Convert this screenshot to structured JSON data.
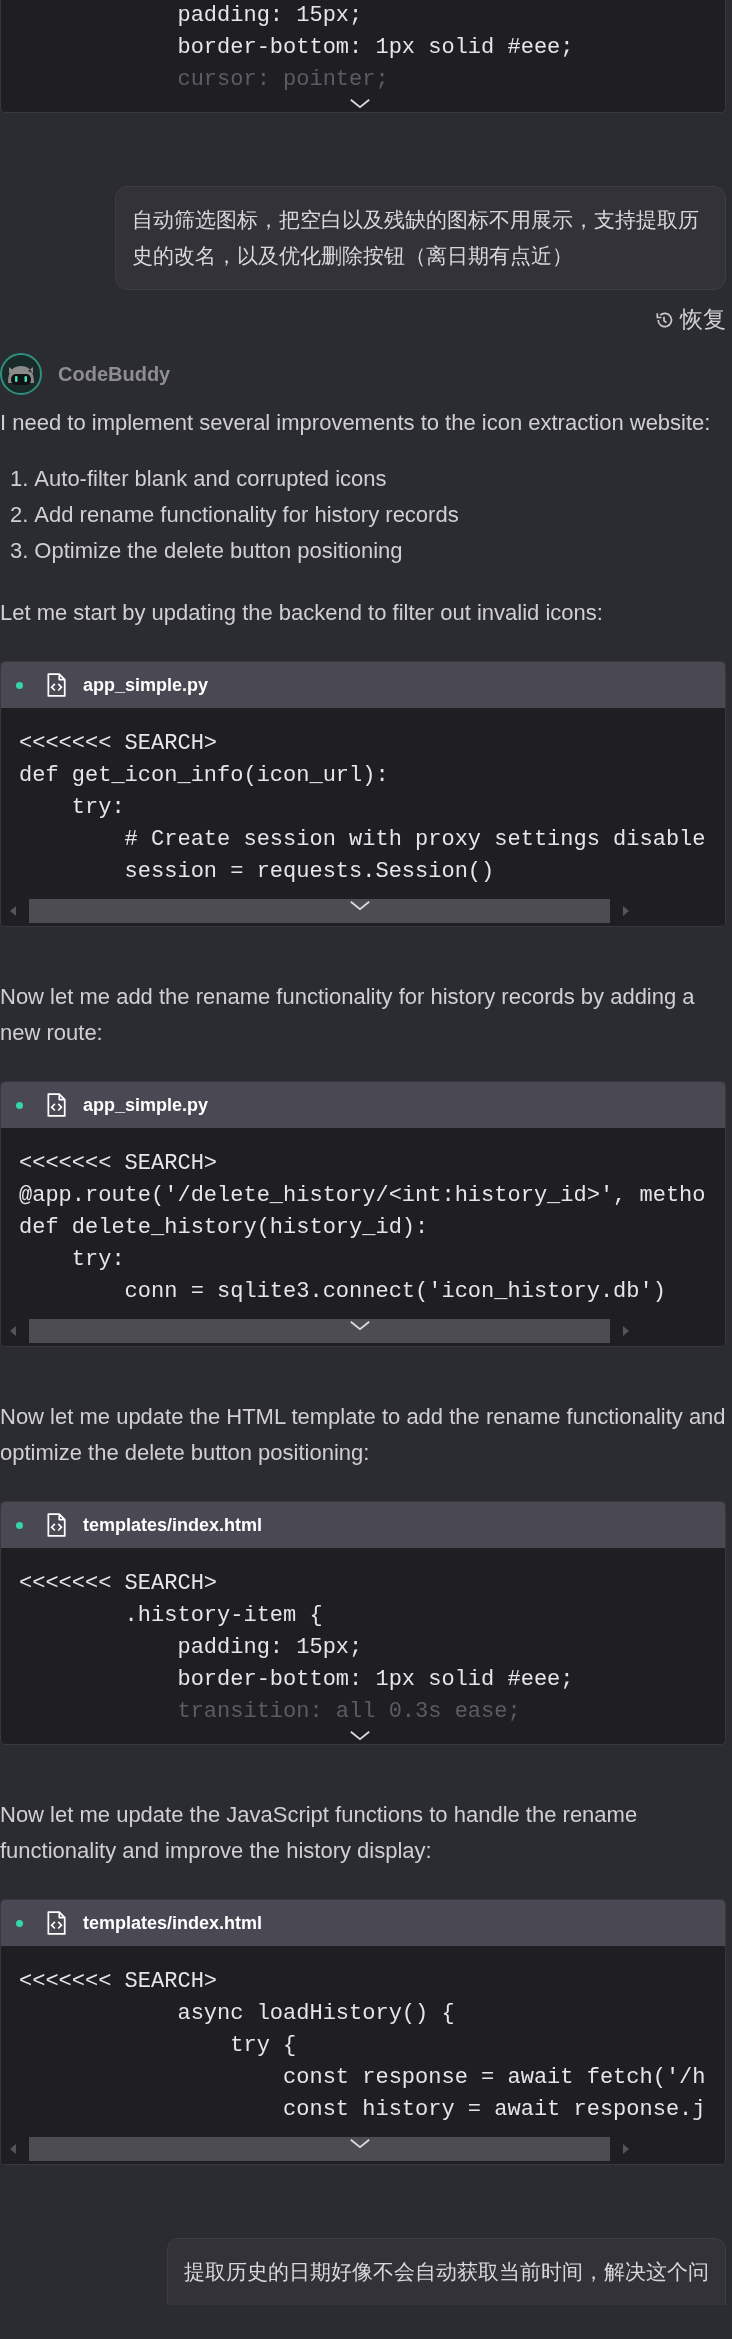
{
  "items": [
    {
      "kind": "code",
      "scrollbar": false,
      "lines": [
        {
          "text": "            padding: 15px;",
          "dim": false
        },
        {
          "text": "            border-bottom: 1px solid #eee;",
          "dim": false
        },
        {
          "text": "            cursor: pointer;",
          "dim": true
        }
      ]
    },
    {
      "kind": "user",
      "text": "自动筛选图标，把空白以及残缺的图标不用展示，支持提取历史的改名，以及优化删除按钮（离日期有点近）",
      "action": "恢复"
    },
    {
      "kind": "assistant",
      "name": "CodeBuddy"
    },
    {
      "kind": "paragraph",
      "text": "I need to implement several improvements to the icon extraction website:"
    },
    {
      "kind": "list",
      "entries": [
        {
          "number": "1.",
          "text": "Auto-filter blank and corrupted icons"
        },
        {
          "number": "2.",
          "text": "Add rename functionality for history records"
        },
        {
          "number": "3.",
          "text": "Optimize the delete button positioning"
        }
      ]
    },
    {
      "kind": "paragraph",
      "text": "Let me start by updating the backend to filter out invalid icons:"
    },
    {
      "kind": "code",
      "file": "app_simple.py",
      "scrollbar": true,
      "lines": [
        {
          "text": "<<<<<<< SEARCH>",
          "dim": false
        },
        {
          "text": "def get_icon_info(icon_url):",
          "dim": false
        },
        {
          "text": "    try:",
          "dim": false
        },
        {
          "text": "        # Create session with proxy settings disable",
          "dim": false
        },
        {
          "text": "        session = requests.Session()",
          "dim": false
        }
      ]
    },
    {
      "kind": "paragraph",
      "text": "Now let me add the rename functionality for history records by adding a new route:"
    },
    {
      "kind": "code",
      "file": "app_simple.py",
      "scrollbar": true,
      "lines": [
        {
          "text": "<<<<<<< SEARCH>",
          "dim": false
        },
        {
          "text": "@app.route('/delete_history/<int:history_id>', metho",
          "dim": false
        },
        {
          "text": "def delete_history(history_id):",
          "dim": false
        },
        {
          "text": "    try:",
          "dim": false
        },
        {
          "text": "        conn = sqlite3.connect('icon_history.db')",
          "dim": false
        }
      ]
    },
    {
      "kind": "paragraph",
      "text": "Now let me update the HTML template to add the rename functionality and optimize the delete button positioning:"
    },
    {
      "kind": "code",
      "file": "templates/index.html",
      "scrollbar": false,
      "lines": [
        {
          "text": "<<<<<<< SEARCH>",
          "dim": false
        },
        {
          "text": "        .history-item {",
          "dim": false
        },
        {
          "text": "            padding: 15px;",
          "dim": false
        },
        {
          "text": "            border-bottom: 1px solid #eee;",
          "dim": false
        },
        {
          "text": "            transition: all 0.3s ease;",
          "dim": true
        }
      ]
    },
    {
      "kind": "paragraph",
      "text": "Now let me update the JavaScript functions to handle the rename functionality and improve the history display:"
    },
    {
      "kind": "code",
      "file": "templates/index.html",
      "scrollbar": true,
      "lines": [
        {
          "text": "<<<<<<< SEARCH>",
          "dim": false
        },
        {
          "text": "            async loadHistory() {",
          "dim": false
        },
        {
          "text": "                try {",
          "dim": false
        },
        {
          "text": "                    const response = await fetch('/h",
          "dim": false
        },
        {
          "text": "                    const history = await response.j",
          "dim": false
        }
      ]
    },
    {
      "kind": "user",
      "text": "提取历史的日期好像不会自动获取当前时间，解决这个问"
    }
  ]
}
